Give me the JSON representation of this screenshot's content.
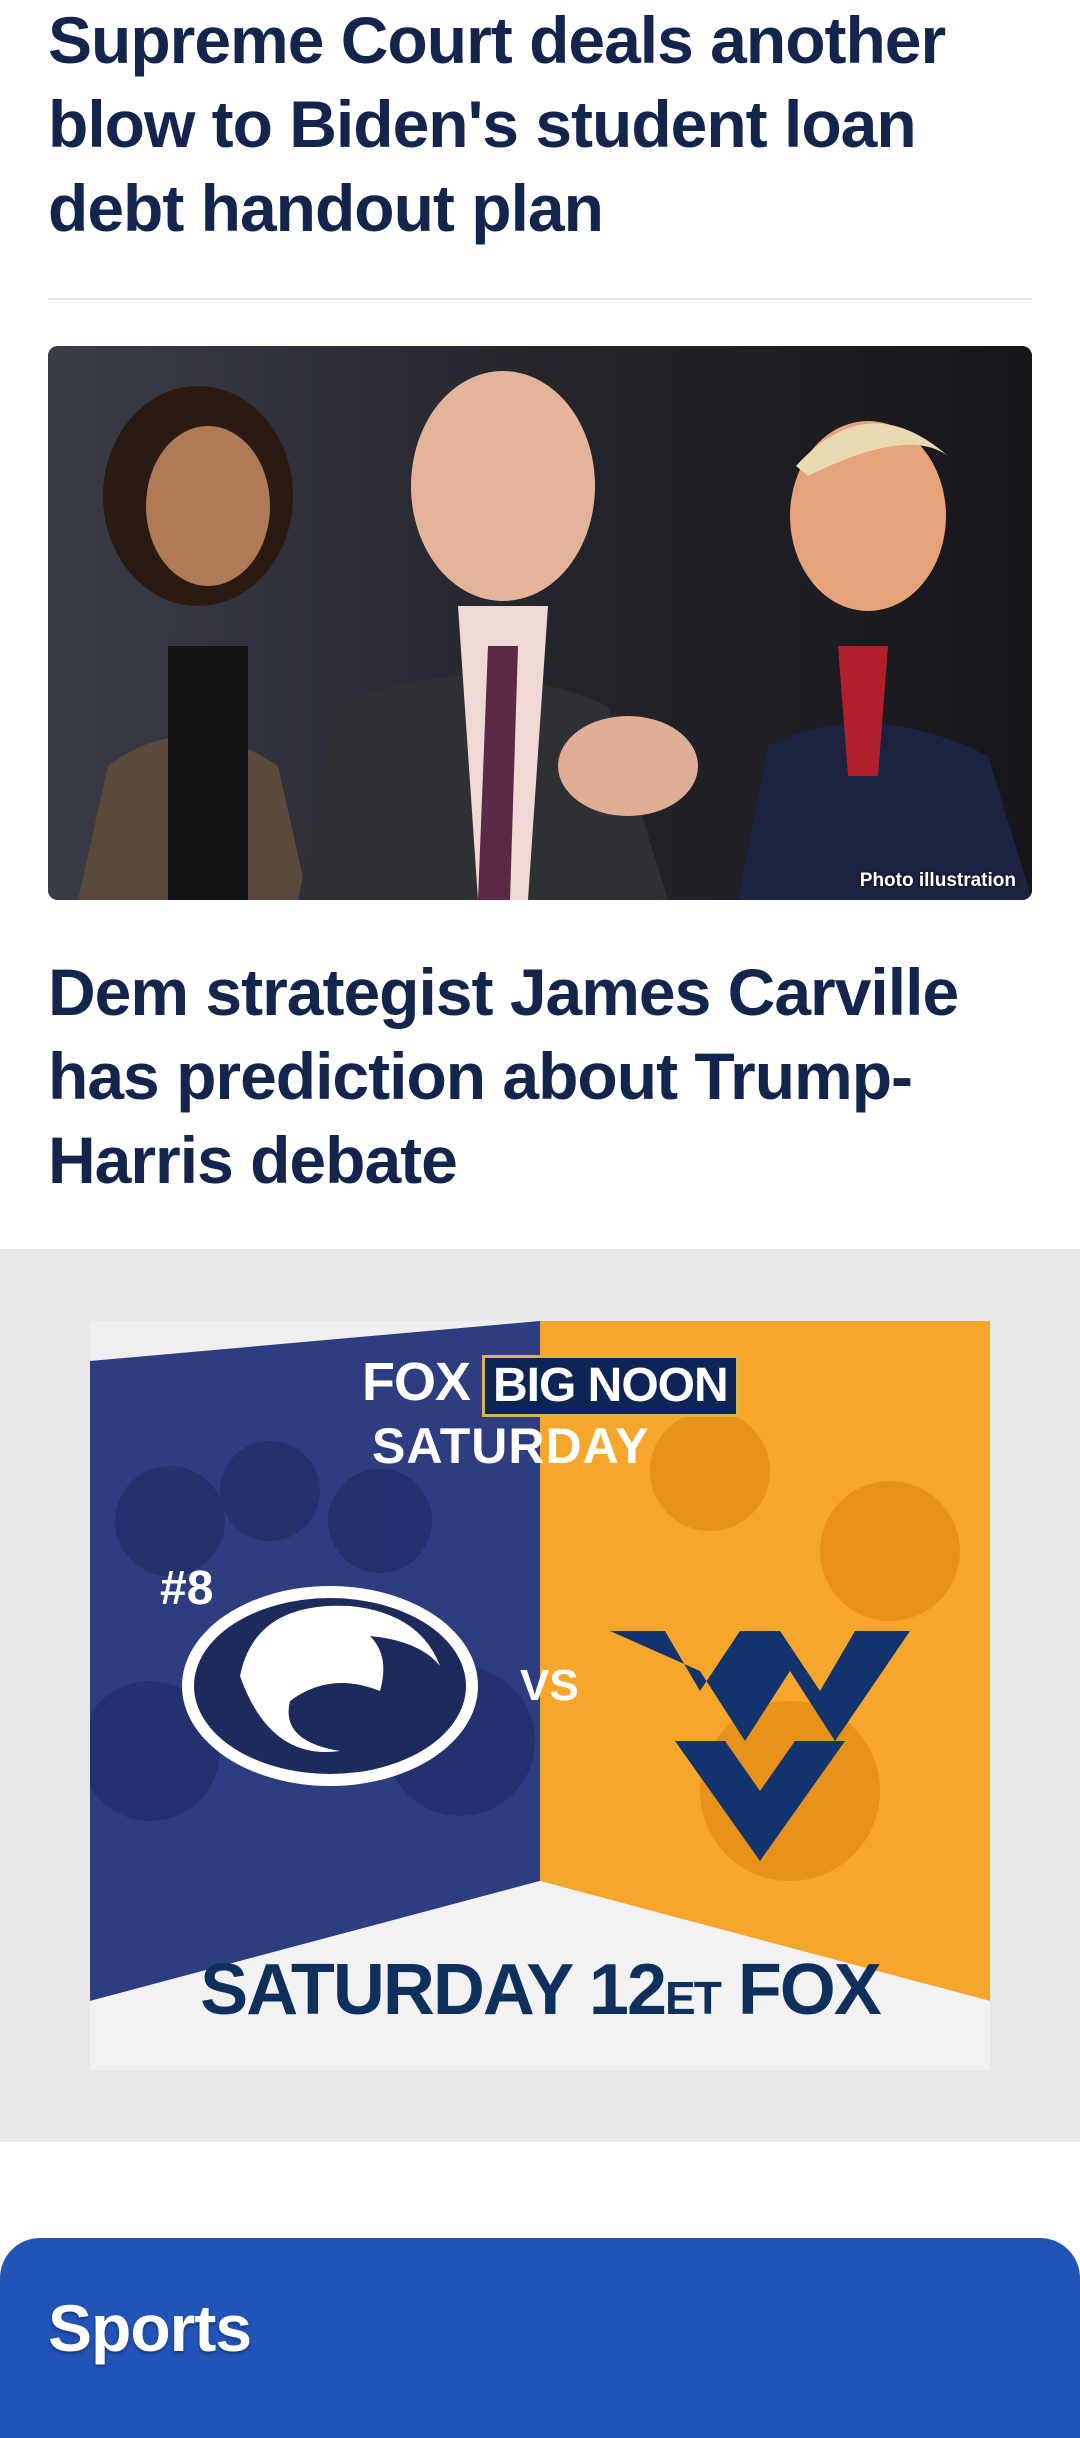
{
  "stories": [
    {
      "headline": "Supreme Court deals another blow to Biden's student loan debt handout plan"
    },
    {
      "headline": "Dem strategist James Carville has prediction about Trump-Harris debate",
      "image_caption": "Photo illustration"
    }
  ],
  "ad": {
    "brand": "FOX",
    "show": "BIG NOON",
    "day": "SATURDAY",
    "rank": "#8",
    "vs": "VS",
    "bottom_time": "SATURDAY 12",
    "bottom_tz": "ET",
    "bottom_network": "FOX",
    "colors": {
      "navy": "#0d2457",
      "orange": "#f6a62a",
      "gold": "#d8b24a"
    }
  },
  "sections": {
    "sports_title": "Sports"
  },
  "colors": {
    "headline": "#13254d",
    "sports_tab": "#2253b7",
    "ad_background": "#e8e8e8"
  }
}
